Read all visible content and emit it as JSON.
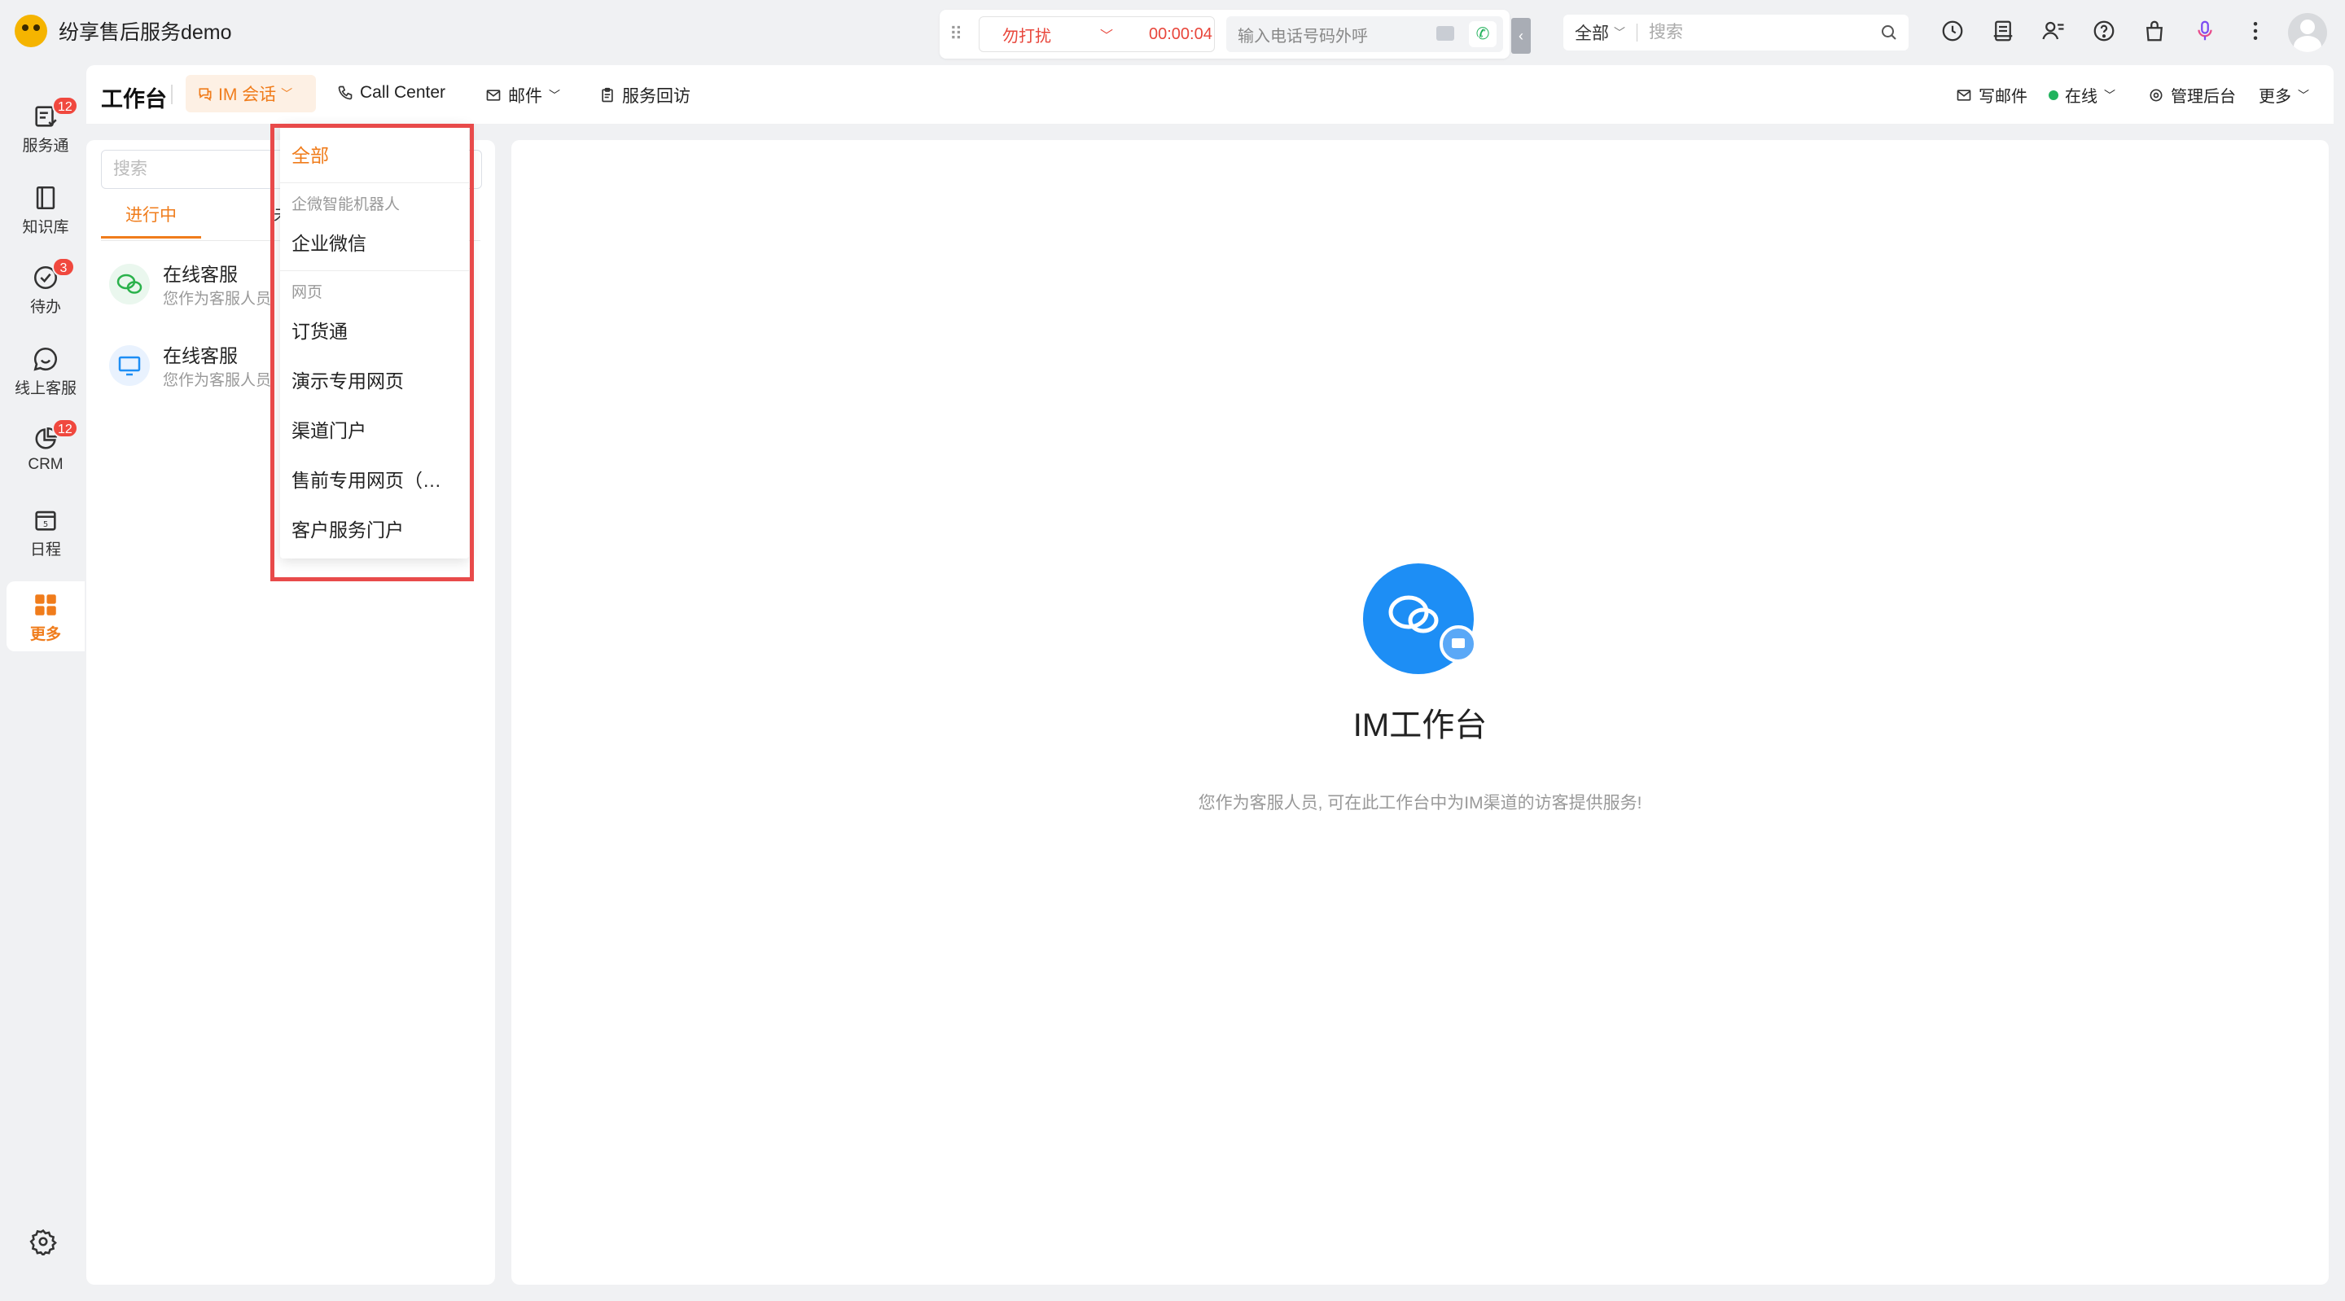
{
  "app": {
    "name": "纷享售后服务demo"
  },
  "callbar": {
    "status": "勿打扰",
    "timer": "00:00:04",
    "dial_placeholder": "输入电话号码外呼"
  },
  "global_search": {
    "scope": "全部",
    "placeholder": "搜索"
  },
  "rail": {
    "items": [
      {
        "label": "服务通",
        "badge": "12",
        "icon": "service-icon"
      },
      {
        "label": "知识库",
        "badge": "",
        "icon": "book-icon"
      },
      {
        "label": "待办",
        "badge": "3",
        "icon": "todo-check-icon"
      },
      {
        "label": "线上客服",
        "badge": "",
        "icon": "chat-bubble-icon"
      },
      {
        "label": "CRM",
        "badge": "12",
        "icon": "crm-pie-icon"
      },
      {
        "label": "日程",
        "badge": "",
        "icon": "calendar-icon"
      },
      {
        "label": "更多",
        "badge": "",
        "icon": "grid-icon"
      }
    ],
    "calendar_day": "5"
  },
  "header": {
    "title": "工作台",
    "tabs": [
      "IM 会话",
      "Call Center",
      "邮件",
      "服务回访"
    ],
    "right": {
      "write_mail": "写邮件",
      "status": "在线",
      "admin": "管理后台",
      "more": "更多"
    }
  },
  "list": {
    "search_placeholder": "搜索",
    "tabs": [
      "进行中",
      "未"
    ],
    "conversations": [
      {
        "name": "在线客服",
        "sub": "您作为客服人员"
      },
      {
        "name": "在线客服",
        "sub": "您作为客服人员"
      }
    ]
  },
  "dropdown": {
    "all": "全部",
    "groups": [
      {
        "title": "企微智能机器人",
        "items": [
          "企业微信"
        ]
      },
      {
        "title": "网页",
        "items": [
          "订货通",
          "演示专用网页",
          "渠道门户",
          "售前专用网页（…",
          "客户服务门户"
        ]
      }
    ]
  },
  "workspace": {
    "title": "IM工作台",
    "desc": "您作为客服人员, 可在此工作台中为IM渠道的访客提供服务!"
  },
  "colors": {
    "accent": "#f07c1b",
    "danger": "#e8463b",
    "primary_blue": "#1d8ef5",
    "online": "#22b35e"
  }
}
